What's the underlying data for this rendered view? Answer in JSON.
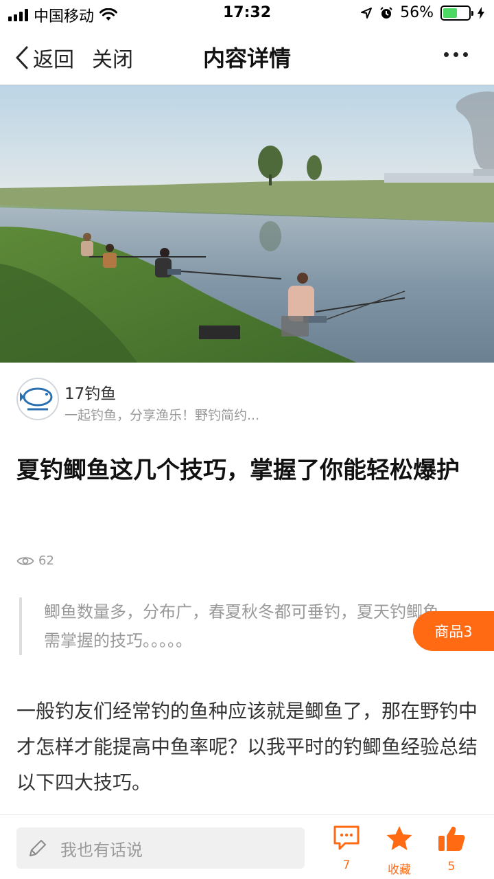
{
  "status_bar": {
    "carrier": "中国移动",
    "time": "17:32",
    "battery": "56%",
    "battery_level": 0.56
  },
  "nav": {
    "back_label": "返回",
    "close_label": "关闭",
    "title": "内容详情"
  },
  "author": {
    "name": "17钓鱼",
    "description": "一起钓鱼，分享渔乐！野钓简约..."
  },
  "article": {
    "title": "夏钓鲫鱼这几个技巧，掌握了你能轻松爆护",
    "views": "62",
    "summary": "鲫鱼数量多，分布广，春夏秋冬都可垂钓，夏天钓鲫鱼，需掌握的技巧。。。。。",
    "body": "一般钓友们经常钓的鱼种应该就是鲫鱼了，那在野钓中才怎样才能提高中鱼率呢？以我平时的钓鲫鱼经验总结以下四大技巧。"
  },
  "goods_tag": "商品3",
  "bottom_bar": {
    "comment_placeholder": "我也有话说",
    "comment_count": "7",
    "favorite_label": "收藏",
    "like_count": "5"
  },
  "colors": {
    "accent": "#ff6a13",
    "battery_green": "#4cd964"
  },
  "icons": [
    "signal-icon",
    "wifi-icon",
    "location-icon",
    "alarm-icon",
    "battery-icon",
    "charging-icon",
    "chevron-left-icon",
    "more-icon",
    "eye-icon",
    "pencil-icon",
    "comment-icon",
    "star-icon",
    "thumbs-up-icon"
  ]
}
